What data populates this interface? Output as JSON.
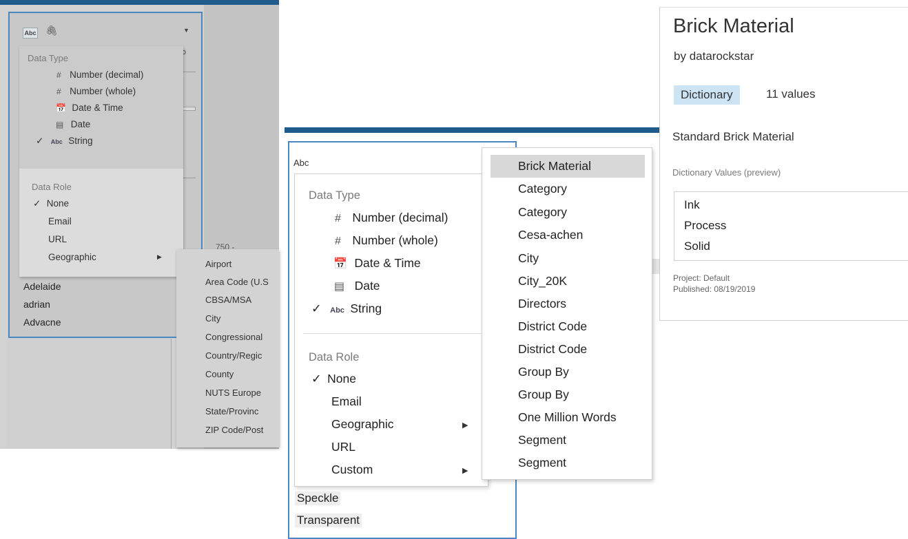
{
  "left_menu": {
    "badge": "Abc",
    "data_type_heading": "Data Type",
    "data_types": [
      {
        "icon": "#",
        "label": "Number (decimal)",
        "checked": false
      },
      {
        "icon": "#",
        "label": "Number (whole)",
        "checked": false
      },
      {
        "icon": "date-time-icon",
        "label": "Date & Time",
        "checked": false
      },
      {
        "icon": "calendar-icon",
        "label": "Date",
        "checked": false
      },
      {
        "icon": "Abc",
        "label": "String",
        "checked": true
      }
    ],
    "data_role_heading": "Data Role",
    "data_roles": [
      {
        "label": "None",
        "checked": true
      },
      {
        "label": "Email",
        "checked": false
      },
      {
        "label": "URL",
        "checked": false
      },
      {
        "label": "Geographic",
        "checked": false,
        "has_submenu": true
      }
    ],
    "check": "✓",
    "values": [
      "Adelaide",
      "adrian",
      "Advacne"
    ],
    "value_axis_label": "750 -"
  },
  "geo_submenu": {
    "items": [
      "Airport",
      "Area Code (U.S",
      "CBSA/MSA",
      "City",
      "Congressional",
      "Country/Regic",
      "County",
      "NUTS Europe",
      "State/Provinc",
      "ZIP Code/Post"
    ]
  },
  "mid_menu": {
    "badge": "Abc",
    "data_type_heading": "Data Type",
    "data_types": [
      {
        "icon": "#",
        "label": "Number (decimal)",
        "checked": false
      },
      {
        "icon": "#",
        "label": "Number (whole)",
        "checked": false
      },
      {
        "icon": "date-time-icon",
        "label": "Date & Time",
        "checked": false
      },
      {
        "icon": "calendar-icon",
        "label": "Date",
        "checked": false
      },
      {
        "icon": "Abc",
        "label": "String",
        "checked": true
      }
    ],
    "data_role_heading": "Data Role",
    "data_roles": [
      {
        "label": "None",
        "checked": true
      },
      {
        "label": "Email",
        "checked": false
      },
      {
        "label": "Geographic",
        "checked": false,
        "has_submenu": true
      },
      {
        "label": "URL",
        "checked": false
      },
      {
        "label": "Custom",
        "checked": false,
        "has_submenu": true
      }
    ],
    "check": "✓",
    "values": [
      "Speckle",
      "Transparent"
    ]
  },
  "dict_submenu": {
    "selected": "Brick Material",
    "items": [
      "Brick Material",
      "Category",
      "Category",
      "Cesa-achen",
      "City",
      "City_20K",
      "Directors",
      "District Code",
      "District Code",
      "Group By",
      "Group By",
      "One Million Words",
      "Segment",
      "Segment"
    ]
  },
  "dict_card": {
    "title": "Brick Material",
    "by_prefix": "by",
    "author": "datarockstar",
    "badge": "Dictionary",
    "count": "11 values",
    "description": "Standard Brick Material",
    "preview_label": "Dictionary Values (preview)",
    "preview_values": [
      "Ink",
      "Process",
      "Solid"
    ],
    "project": "Project: Default",
    "published": "Published: 08/19/2019"
  },
  "colors": {
    "accent_blue": "#4a87bf",
    "topbar_blue": "#1f5b8c",
    "dictionary_badge": "#cde4f4"
  }
}
